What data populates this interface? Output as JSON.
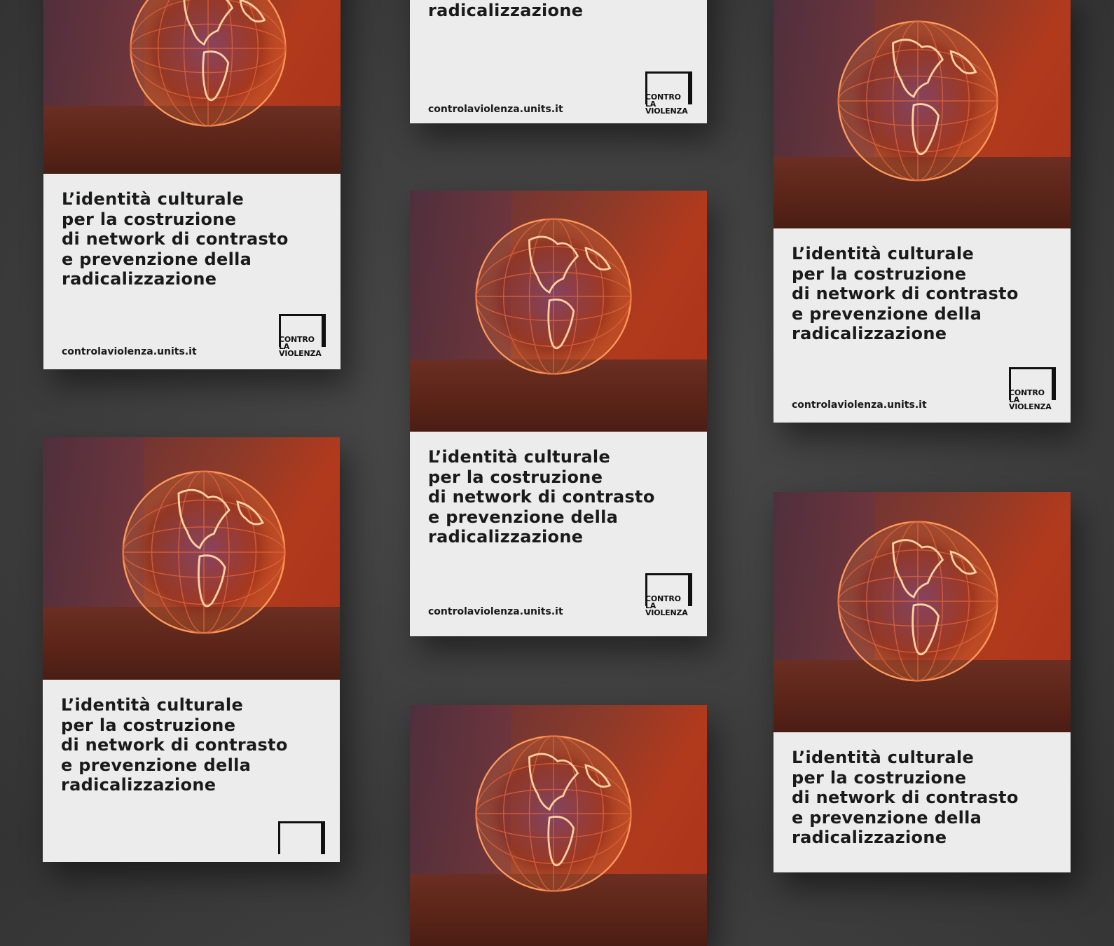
{
  "poster": {
    "title_lines": "L’identità culturale\nper la costruzione\ndi network di contrasto\ne prevenzione della\nradicalizzazione",
    "url": "controlaviolenza.units.it",
    "logo_line1": "CONTRO",
    "logo_line2": "LA",
    "logo_line3": "VIOLENZA"
  },
  "colors": {
    "background": "#3f3f3f",
    "card": "#ececec",
    "text": "#1a1a1a",
    "glow": "#ff7a3a"
  },
  "icons": [
    "globe-artwork",
    "logo-frame"
  ]
}
